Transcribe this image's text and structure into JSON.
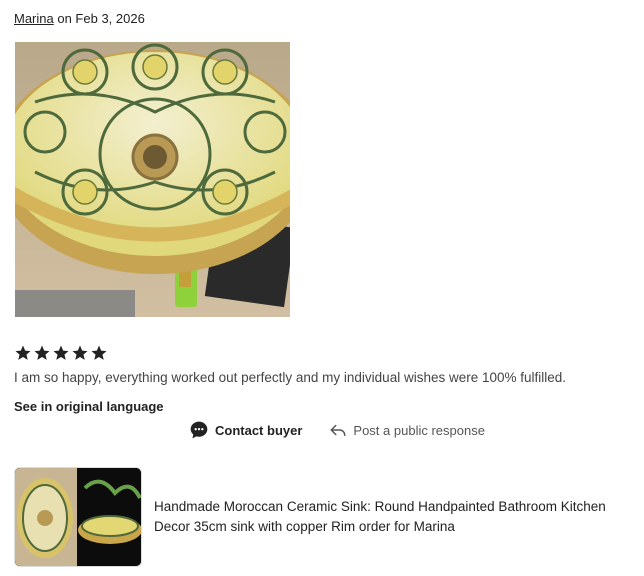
{
  "review": {
    "author": "Marina",
    "date_text": " on Feb 3, 2026",
    "rating": 5,
    "text": "I am so happy, everything worked out perfectly and my individual wishes were 100% fulfilled.",
    "see_original": "See in original language"
  },
  "actions": {
    "contact_label": "Contact buyer",
    "public_response_label": "Post a public response"
  },
  "listing": {
    "title": "Handmade Moroccan Ceramic Sink: Round Handpainted Bathroom Kitchen Decor 35cm sink with copper Rim order for Marina"
  },
  "colors": {
    "star": "#222222",
    "ceramic_yellow": "#e3d774",
    "ceramic_green": "#4e6a3c",
    "brass": "#c9a64a"
  }
}
